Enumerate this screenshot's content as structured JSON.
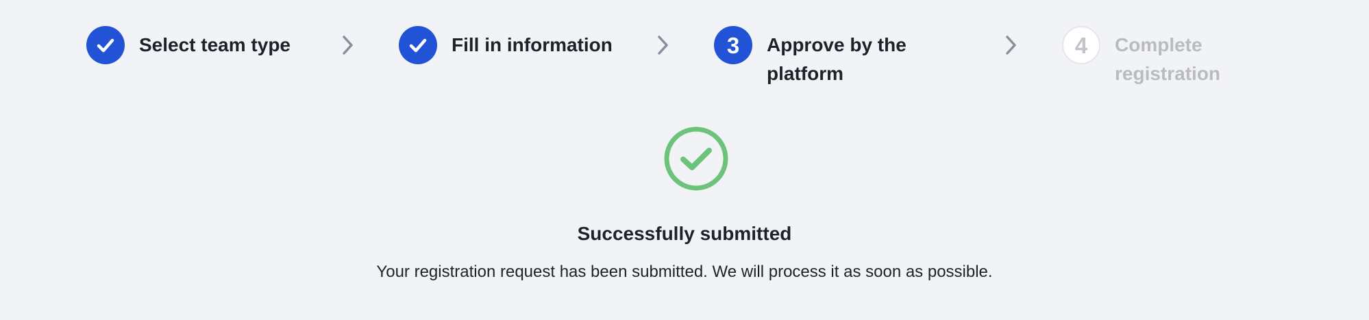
{
  "steps": [
    {
      "label": "Select team type",
      "status": "done",
      "icon": "check-icon"
    },
    {
      "label": "Fill in information",
      "status": "done",
      "icon": "check-icon"
    },
    {
      "label_line1": "Approve by the",
      "label_line2": "platform",
      "number": "3",
      "status": "active"
    },
    {
      "label_line1": "Complete",
      "label_line2": "registration",
      "number": "4",
      "status": "pending"
    }
  ],
  "separator_icon": "chevron-right-icon",
  "result": {
    "icon": "success-check-circle-icon",
    "title": "Successfully submitted",
    "description": "Your registration request has been submitted. We will process it as soon as possible."
  },
  "colors": {
    "primary": "#2253d6",
    "success": "#6cc47a",
    "background": "#f2f3f6",
    "text": "#1d2129",
    "muted": "#b9bbc0"
  }
}
